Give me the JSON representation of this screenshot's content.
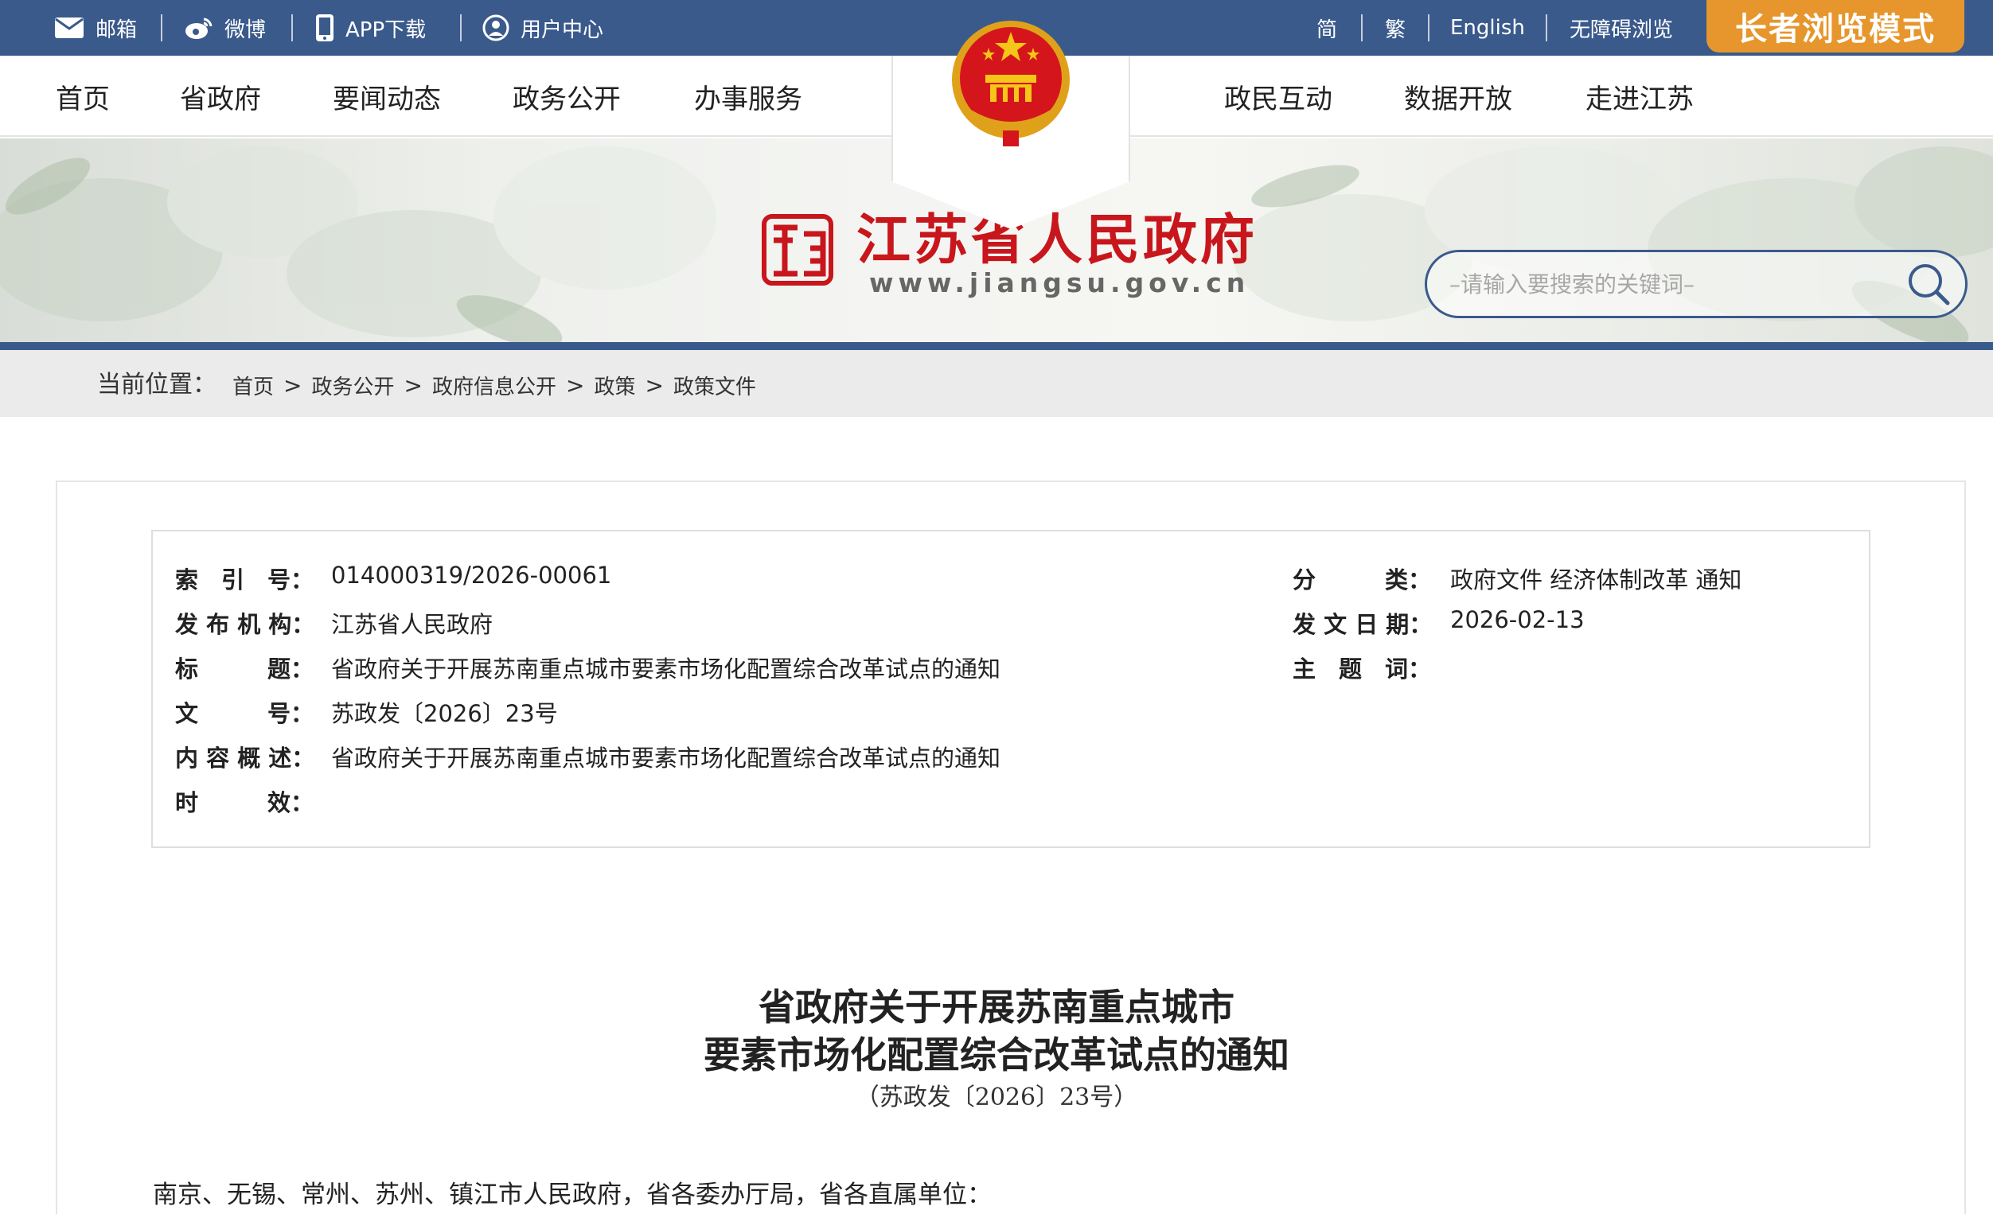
{
  "topbar": {
    "mail": "邮箱",
    "weibo": "微博",
    "app": "APP下载",
    "user": "用户中心",
    "simplified": "简",
    "traditional": "繁",
    "english": "English",
    "accessible": "无障碍浏览",
    "elder_mode": "长者浏览模式"
  },
  "nav": {
    "home": "首页",
    "province": "省政府",
    "news": "要闻动态",
    "gov_open": "政务公开",
    "services": "办事服务",
    "interaction": "政民互动",
    "open_data": "数据开放",
    "about": "走进江苏"
  },
  "banner": {
    "site_name": "江苏省人民政府",
    "site_url": "www.jiangsu.gov.cn",
    "search_placeholder": "–请输入要搜索的关键词–"
  },
  "breadcrumb": {
    "label": "当前位置：",
    "items": [
      "首页",
      "政务公开",
      "政府信息公开",
      "政策",
      "政策文件"
    ],
    "separator": ">"
  },
  "meta": {
    "index_label": "索　引　号：",
    "index_value": "014000319/2026-00061",
    "category_label": "分　　　类：",
    "category_value": "政府文件 经济体制改革 通知",
    "issuer_label": "发 布 机 构：",
    "issuer_value": "江苏省人民政府",
    "date_label": "发 文 日 期：",
    "date_value": "2026-02-13",
    "title_label": "标　　　题：",
    "title_value": "省政府关于开展苏南重点城市要素市场化配置综合改革试点的通知",
    "keywords_label": "主　题　词：",
    "keywords_value": "",
    "docno_label": "文　　　号：",
    "docno_value": "苏政发〔2026〕23号",
    "summary_label": "内 容 概 述：",
    "summary_value": "省政府关于开展苏南重点城市要素市场化配置综合改革试点的通知",
    "validity_label": "时　　　效：",
    "validity_value": ""
  },
  "document": {
    "title_line1": "省政府关于开展苏南重点城市",
    "title_line2": "要素市场化配置综合改革试点的通知",
    "doc_number": "（苏政发〔2026〕23号）",
    "addressee": "南京、无锡、常州、苏州、镇江市人民政府，省各委办厅局，省各直属单位："
  },
  "colors": {
    "primary": "#3a5a8c",
    "accent": "#e6962c",
    "brand_red": "#c8161d"
  }
}
